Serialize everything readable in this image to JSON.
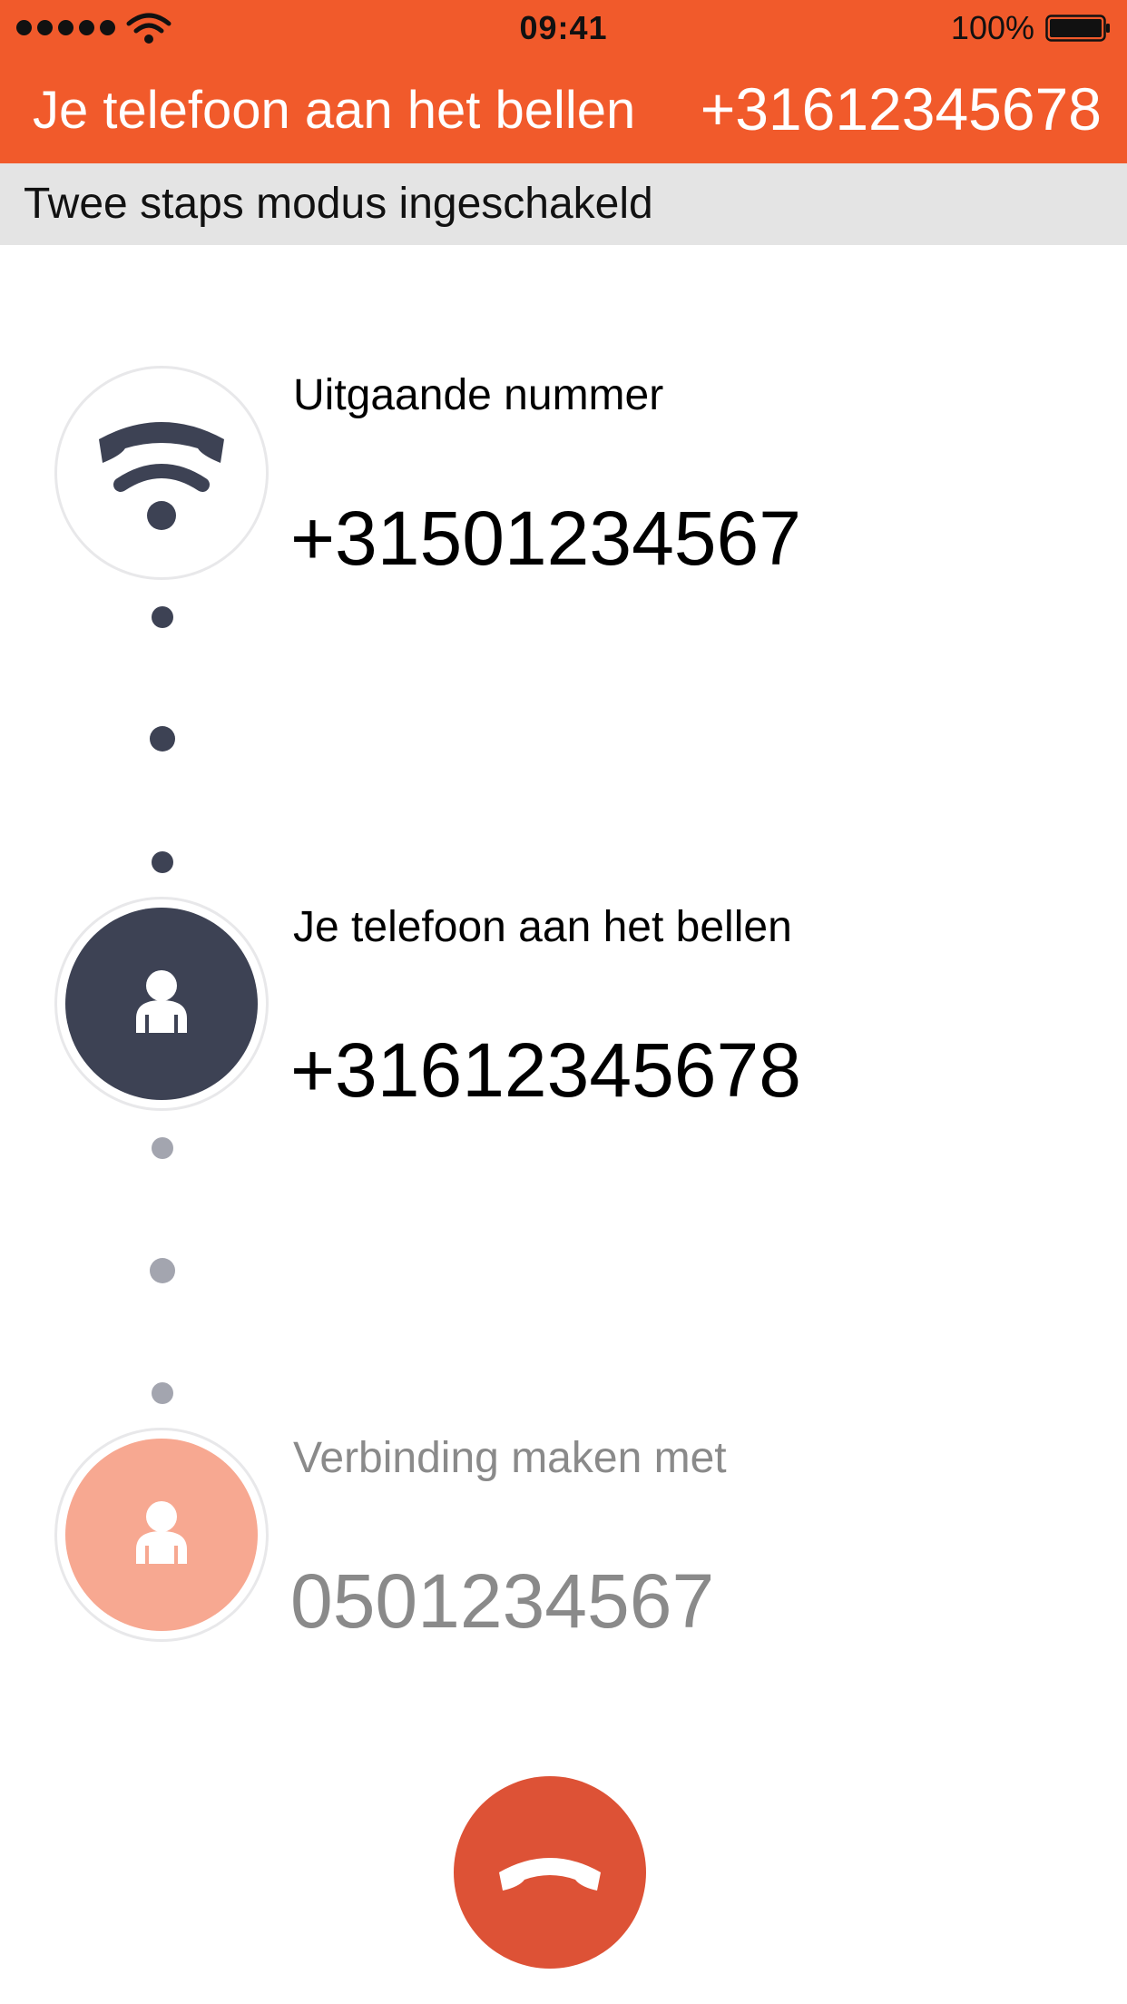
{
  "status_bar": {
    "time": "09:41",
    "battery_percent": "100%",
    "signal_bars": 5,
    "icons": [
      "signal-dots",
      "wifi-icon",
      "battery-icon"
    ]
  },
  "header": {
    "title": "Je telefoon aan het bellen",
    "number": "+31612345678",
    "background_color": "#f15a2b"
  },
  "banner": {
    "text": "Twee staps modus ingeschakeld"
  },
  "steps": [
    {
      "label": "Uitgaande nummer",
      "number": "+31501234567",
      "icon": "phone-signal-icon",
      "state": "done"
    },
    {
      "label": "Je telefoon aan het bellen",
      "number": "+31612345678",
      "icon": "person-icon",
      "state": "active",
      "color": "#3d4254"
    },
    {
      "label": "Verbinding maken met",
      "number": "0501234567",
      "icon": "person-icon",
      "state": "pending",
      "color": "#f7a891"
    }
  ],
  "end_call": {
    "icon": "hang-up-icon",
    "color": "#dd5236"
  }
}
